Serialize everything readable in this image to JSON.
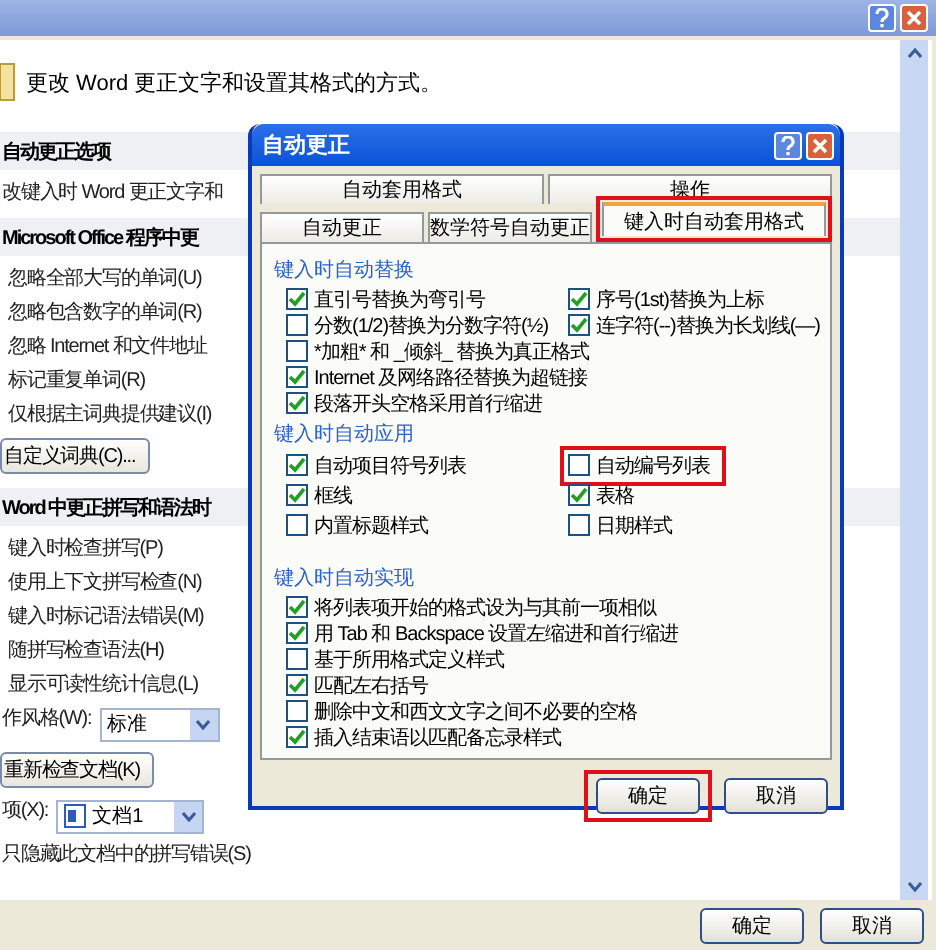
{
  "window": {
    "intro": "更改 Word 更正文字和设置其格式的方式。"
  },
  "background_items": [
    {
      "kind": "header",
      "label": "自动更正选项"
    },
    {
      "kind": "text",
      "label": "改键入时 Word 更正文字和"
    },
    {
      "kind": "header",
      "label": "Microsoft Office 程序中更"
    },
    {
      "kind": "item",
      "label": "忽略全部大写的单词(U)"
    },
    {
      "kind": "item",
      "label": "忽略包含数字的单词(R)"
    },
    {
      "kind": "item",
      "label": "忽略 Internet 和文件地址"
    },
    {
      "kind": "item",
      "label": "标记重复单词(R)"
    },
    {
      "kind": "item",
      "label": "仅根据主词典提供建议(I)"
    },
    {
      "kind": "button",
      "label": "自定义词典(C)..."
    },
    {
      "kind": "header",
      "label": "Word 中更正拼写和语法时"
    },
    {
      "kind": "item",
      "label": "键入时检查拼写(P)"
    },
    {
      "kind": "item",
      "label": "使用上下文拼写检查(N)"
    },
    {
      "kind": "item",
      "label": "键入时标记语法错误(M)"
    },
    {
      "kind": "item",
      "label": "随拼写检查语法(H)"
    },
    {
      "kind": "item",
      "label": "显示可读性统计信息(L)"
    },
    {
      "kind": "select",
      "label": "作风格(W):",
      "value": "标准",
      "doc_icon": false
    },
    {
      "kind": "button",
      "label": "重新检查文档(K)"
    },
    {
      "kind": "select",
      "label": "项(X):",
      "value": "文档1",
      "doc_icon": true
    },
    {
      "kind": "text",
      "label": "只隐藏此文档中的拼写错误(S)"
    }
  ],
  "footer_buttons": [
    "确定",
    "取消"
  ],
  "dialog": {
    "title": "自动更正",
    "tabs_back": [
      {
        "label": "自动套用格式",
        "selected": false
      },
      {
        "label": "操作",
        "selected": false
      }
    ],
    "tabs_front": [
      {
        "label": "自动更正",
        "selected": false,
        "highlighted": false
      },
      {
        "label": "数学符号自动更正",
        "selected": false,
        "highlighted": false
      },
      {
        "label": "键入时自动套用格式",
        "selected": true,
        "highlighted": true
      }
    ],
    "groups": [
      {
        "title": "键入时自动替换",
        "rows": [
          [
            {
              "label": "直引号替换为弯引号",
              "checked": true,
              "highlighted": false
            },
            {
              "label": "序号(1st)替换为上标",
              "checked": true,
              "highlighted": false
            }
          ],
          [
            {
              "label": "分数(1/2)替换为分数字符(½)",
              "checked": false,
              "highlighted": false
            },
            {
              "label": "连字符(--)替换为长划线(—)",
              "checked": true,
              "highlighted": false
            }
          ],
          [
            {
              "label": "*加粗* 和 _倾斜_ 替换为真正格式",
              "checked": false,
              "highlighted": false
            }
          ],
          [
            {
              "label": "Internet 及网络路径替换为超链接",
              "checked": true,
              "highlighted": false
            }
          ],
          [
            {
              "label": "段落开头空格采用首行缩进",
              "checked": true,
              "highlighted": false
            }
          ]
        ]
      },
      {
        "title": "键入时自动应用",
        "rows": [
          [
            {
              "label": "自动项目符号列表",
              "checked": true,
              "highlighted": false
            },
            {
              "label": "自动编号列表",
              "checked": false,
              "highlighted": true
            }
          ],
          [
            {
              "label": "框线",
              "checked": true,
              "highlighted": false
            },
            {
              "label": "表格",
              "checked": true,
              "highlighted": false
            }
          ],
          [
            {
              "label": "内置标题样式",
              "checked": false,
              "highlighted": false
            },
            {
              "label": "日期样式",
              "checked": false,
              "highlighted": false
            }
          ]
        ]
      },
      {
        "title": "键入时自动实现",
        "rows": [
          [
            {
              "label": "将列表项开始的格式设为与其前一项相似",
              "checked": true,
              "highlighted": false
            }
          ],
          [
            {
              "label": "用 Tab 和 Backspace 设置左缩进和首行缩进",
              "checked": true,
              "highlighted": false
            }
          ],
          [
            {
              "label": "基于所用格式定义样式",
              "checked": false,
              "highlighted": false
            }
          ],
          [
            {
              "label": "匹配左右括号",
              "checked": true,
              "highlighted": false
            }
          ],
          [
            {
              "label": "删除中文和西文文字之间不必要的空格",
              "checked": false,
              "highlighted": false
            }
          ],
          [
            {
              "label": "插入结束语以匹配备忘录样式",
              "checked": true,
              "highlighted": false
            }
          ]
        ]
      }
    ],
    "buttons": [
      {
        "label": "确定",
        "highlighted": true
      },
      {
        "label": "取消",
        "highlighted": false
      }
    ]
  }
}
